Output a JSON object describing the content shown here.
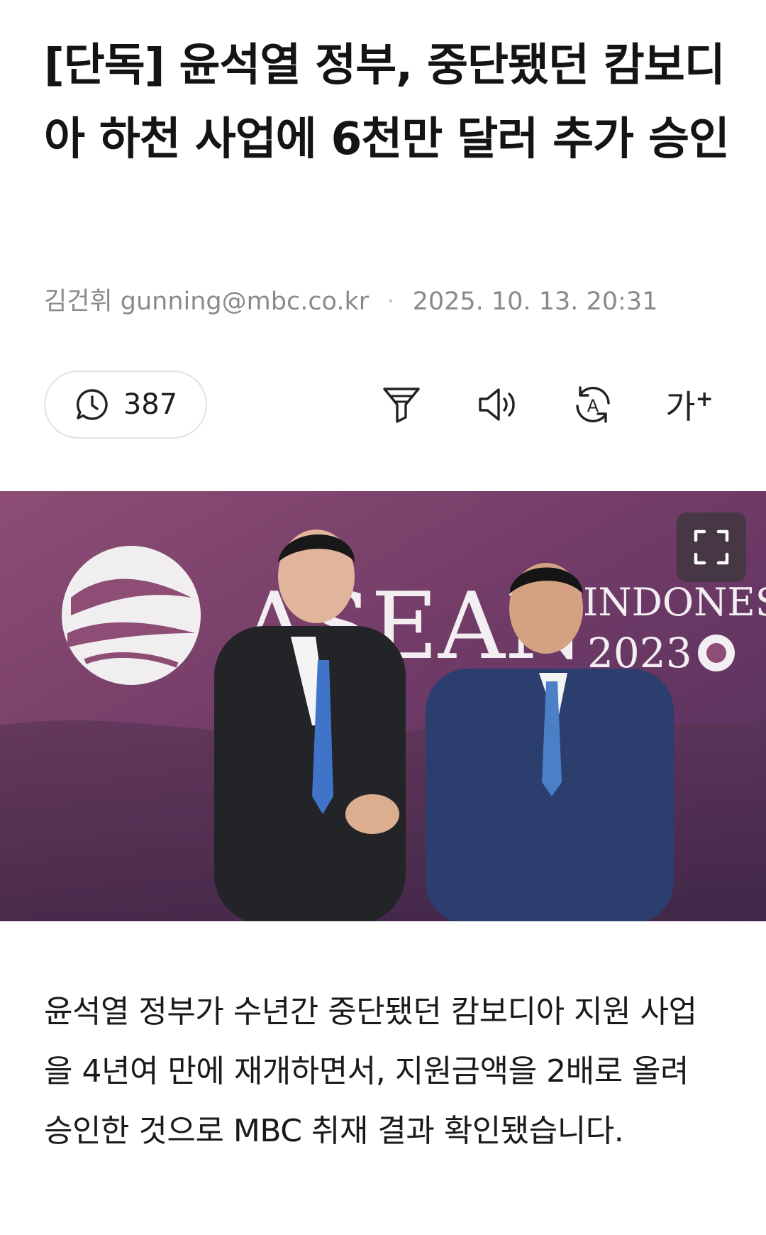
{
  "article": {
    "headline": "[단독] 윤석열 정부, 중단됐던 캄보디아 하천 사업에 6천만 달러 추가 승인",
    "author": "김건휘",
    "email": "gunning@mbc.co.kr",
    "separator": "·",
    "datetime": "2025. 10. 13. 20:31",
    "view_count": "387",
    "body": "윤석열 정부가 수년간 중단됐던 캄보디아 지원 사업을 4년여 만에 재개하면서, 지원금액을 2배로 올려 승인한 것으로 MBC 취재 결과 확인됐습니다."
  },
  "toolbar": {
    "view_icon": "clock-bubble-icon",
    "filter_icon": "filter-icon",
    "audio_icon": "speaker-icon",
    "translate_icon": "translate-a-icon",
    "font_label": "가",
    "font_plus": "+"
  },
  "photo": {
    "backdrop_text_1": "ASEAN",
    "backdrop_text_2": "INDONES",
    "backdrop_text_3": "2023",
    "expand_icon": "fullscreen-icon"
  },
  "colors": {
    "headline": "#141414",
    "meta": "#8a8a8a",
    "backdrop": "#7a3a63"
  }
}
